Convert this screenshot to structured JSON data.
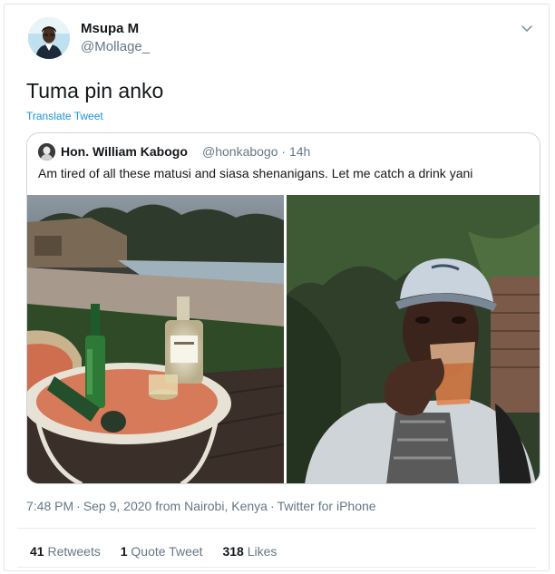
{
  "tweet": {
    "author_name": "Msupa M",
    "author_handle": "@Mollage_",
    "text": "Tuma pin anko",
    "translate_label": "Translate Tweet",
    "menu_icon": "chevron-down-icon"
  },
  "quoted": {
    "author_name": "Hon. William Kabogo",
    "author_handle": "@honkabogo",
    "time": "· 14h",
    "text": "Am tired of all these matusi and siasa shenanigans. Let me catch a drink yani",
    "photos": [
      "poolside-table-with-bottles-photo",
      "man-drinking-selfie-photo"
    ]
  },
  "meta": {
    "time": "7:48 PM",
    "date": "Sep 9, 2020 from Nairobi, Kenya",
    "source": "Twitter for iPhone"
  },
  "stats": {
    "retweets_count": "41",
    "retweets_label": "Retweets",
    "quotes_count": "1",
    "quotes_label": "Quote Tweet",
    "likes_count": "318",
    "likes_label": "Likes"
  },
  "colors": {
    "link": "#1b95e0",
    "secondary_text": "#657786",
    "border": "#e1e8ed"
  }
}
